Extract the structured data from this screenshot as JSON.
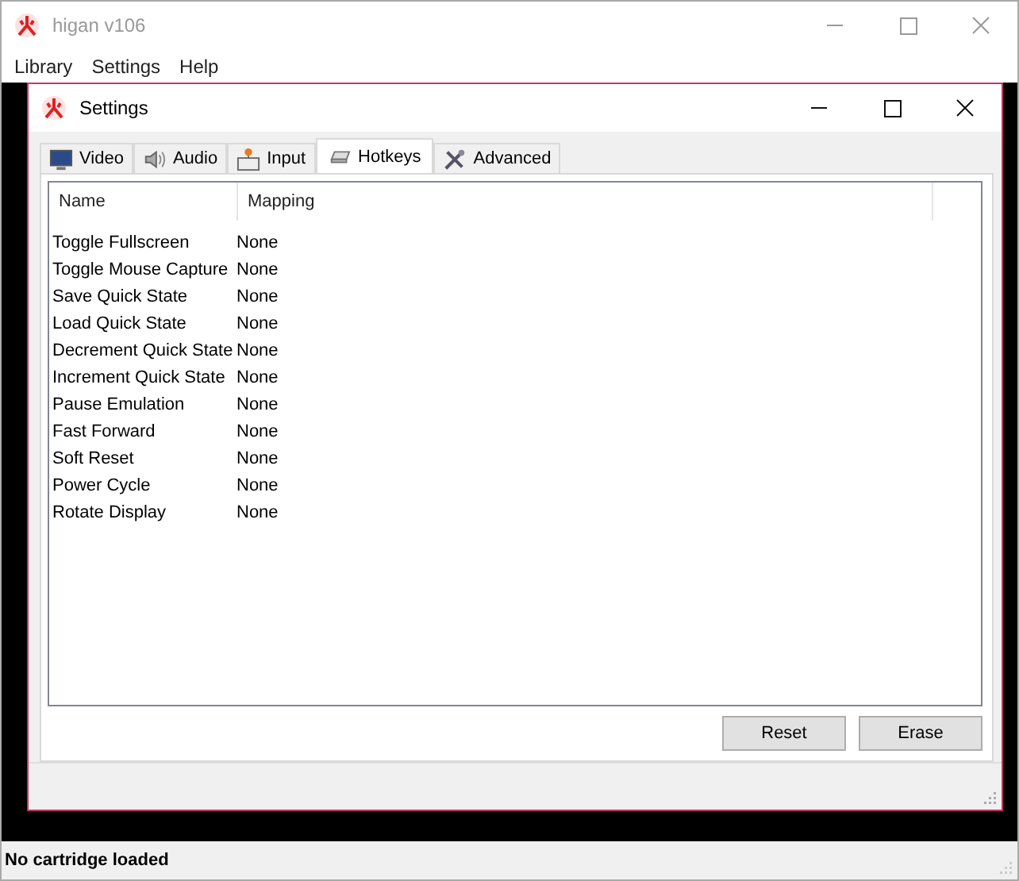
{
  "window": {
    "title": "higan v106"
  },
  "menu": [
    "Library",
    "Settings",
    "Help"
  ],
  "dialog": {
    "title": "Settings",
    "tabs": [
      {
        "label": "Video",
        "selected": false
      },
      {
        "label": "Audio",
        "selected": false
      },
      {
        "label": "Input",
        "selected": false
      },
      {
        "label": "Hotkeys",
        "selected": true
      },
      {
        "label": "Advanced",
        "selected": false
      }
    ],
    "table": {
      "columns": [
        "Name",
        "Mapping"
      ],
      "rows": [
        [
          "Toggle Fullscreen",
          "None"
        ],
        [
          "Toggle Mouse Capture",
          "None"
        ],
        [
          "Save Quick State",
          "None"
        ],
        [
          "Load Quick State",
          "None"
        ],
        [
          "Decrement Quick State",
          "None"
        ],
        [
          "Increment Quick State",
          "None"
        ],
        [
          "Pause Emulation",
          "None"
        ],
        [
          "Fast Forward",
          "None"
        ],
        [
          "Soft Reset",
          "None"
        ],
        [
          "Power Cycle",
          "None"
        ],
        [
          "Rotate Display",
          "None"
        ]
      ]
    },
    "buttons": [
      "Reset",
      "Erase"
    ]
  },
  "status_bar": "No cartridge loaded"
}
